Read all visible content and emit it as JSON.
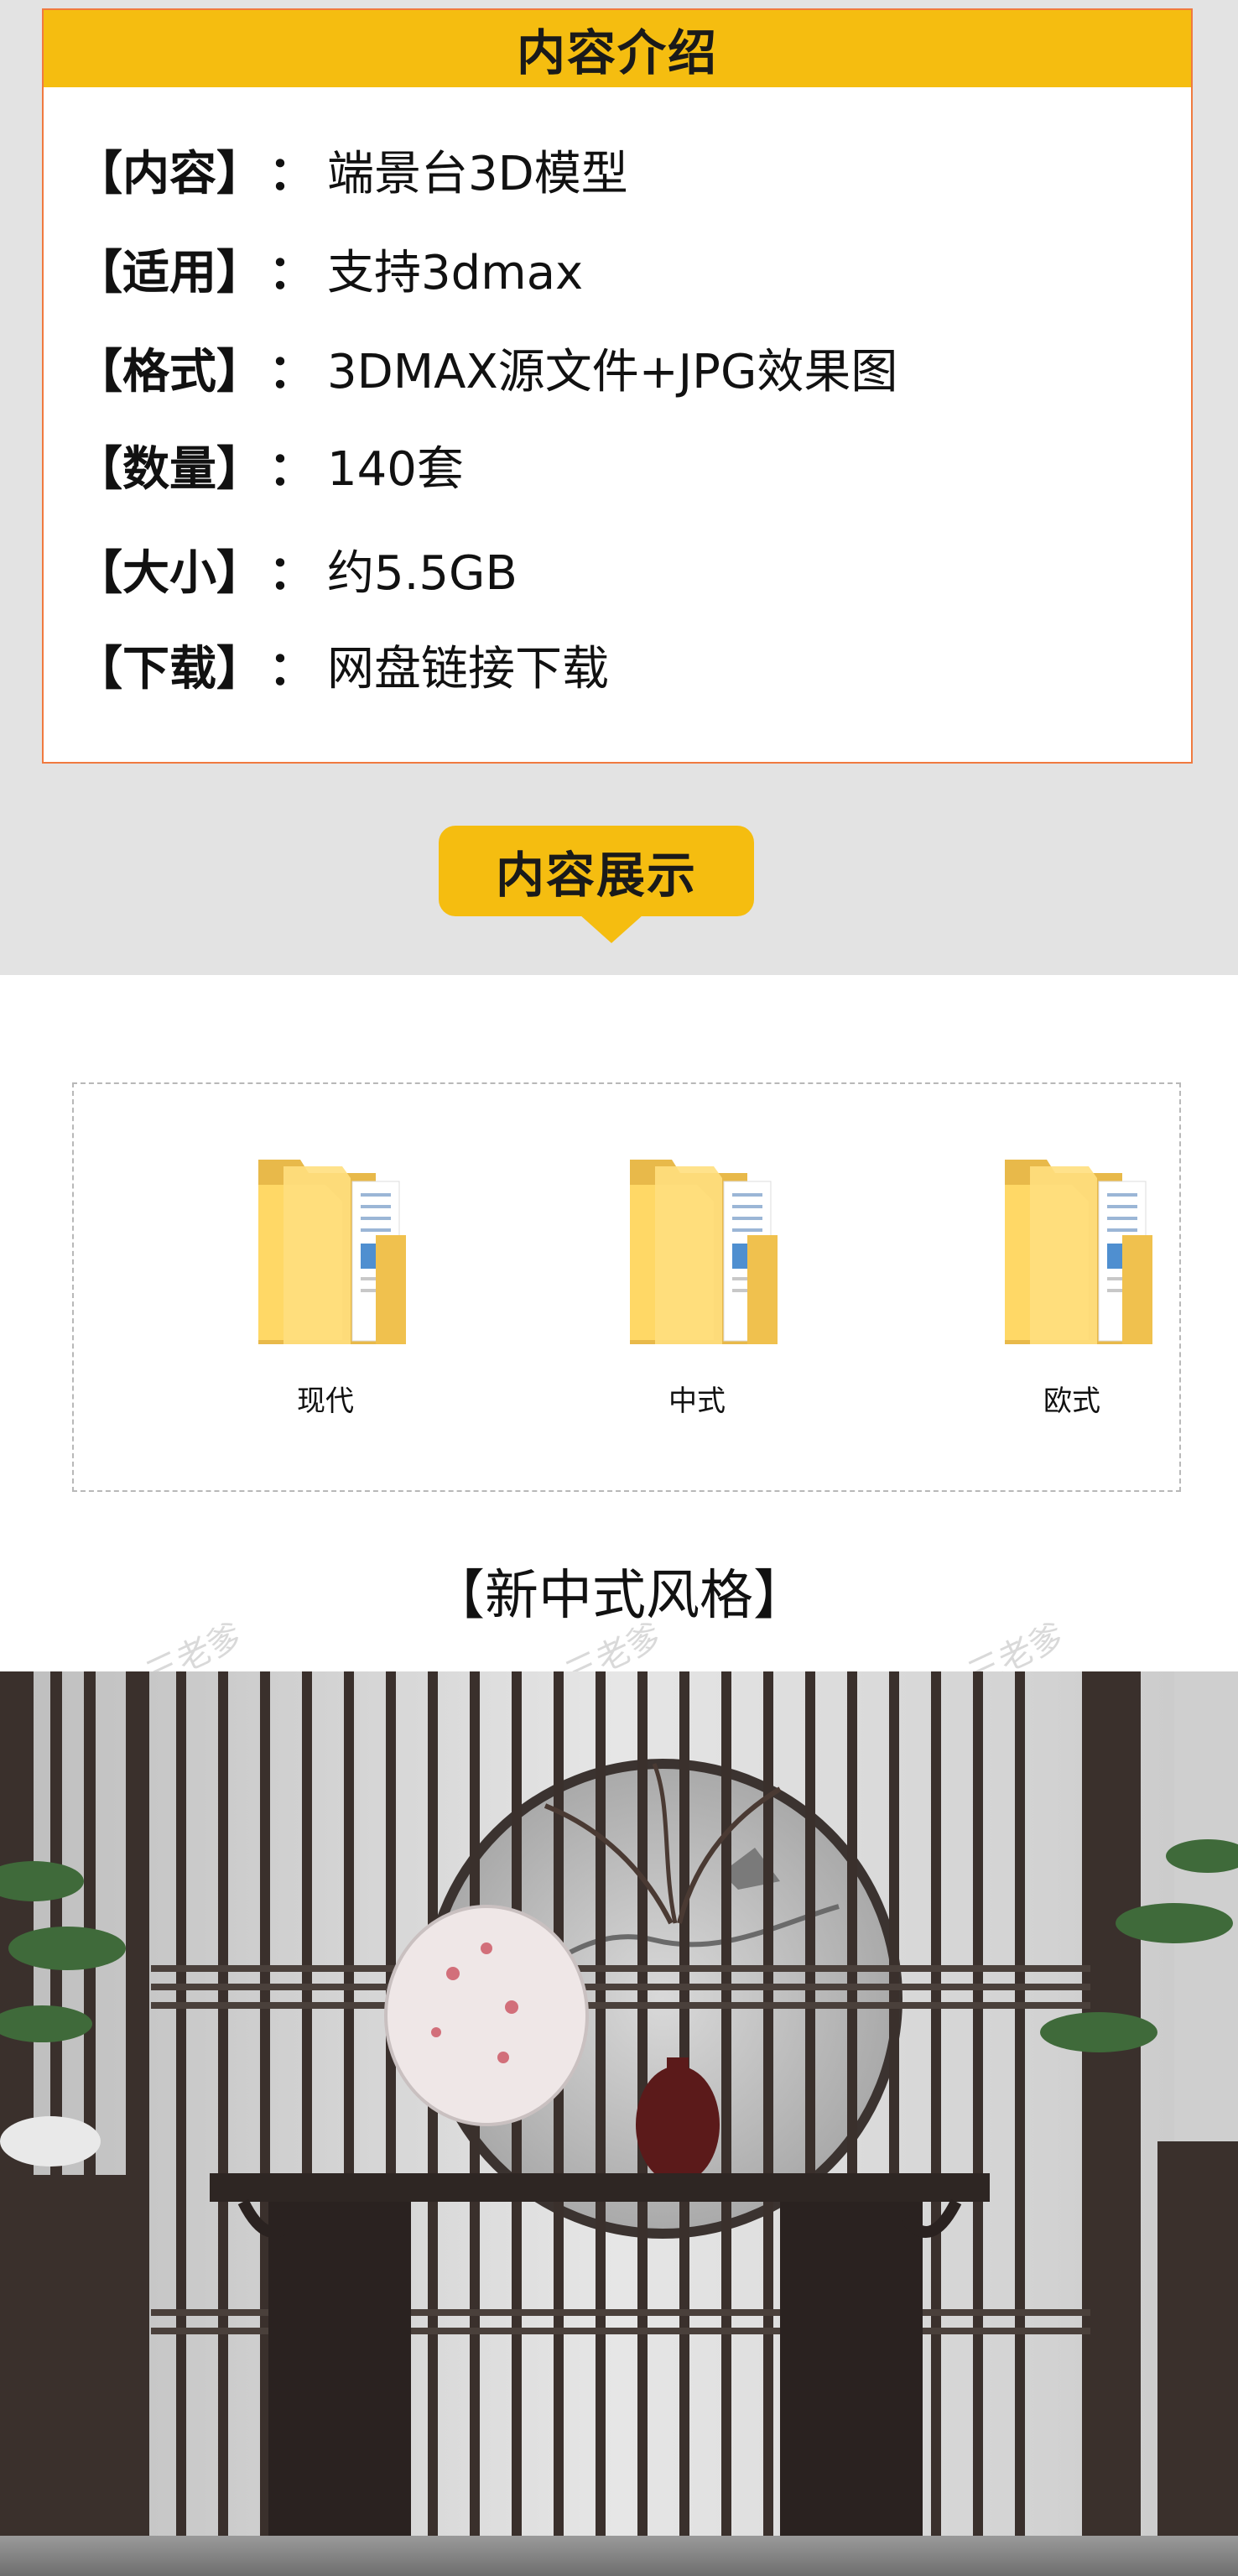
{
  "intro": {
    "title": "内容介绍",
    "rows": [
      {
        "label": "【内容】",
        "sep": "：",
        "value": "端景台3D模型"
      },
      {
        "label": "【适用】",
        "sep": "：",
        "value": "支持3dmax"
      },
      {
        "label": "【格式】",
        "sep": "：",
        "value": "3DMAX源文件+JPG效果图"
      },
      {
        "label": "【数量】",
        "sep": "：",
        "value": "140套"
      },
      {
        "label": "【大小】",
        "sep": "：",
        "value": "约5.5GB"
      },
      {
        "label": "【下载】",
        "sep": "：",
        "value": "网盘链接下载"
      }
    ]
  },
  "display": {
    "badge": "内容展示"
  },
  "folders": [
    {
      "name": "现代",
      "icon": "folder-icon"
    },
    {
      "name": "中式",
      "icon": "folder-icon"
    },
    {
      "name": "欧式",
      "icon": "folder-icon"
    }
  ],
  "style_title": "【新中式风格】",
  "watermark": "三老爹",
  "colors": {
    "accent": "#f5bd10",
    "border": "#f07a40",
    "band": "#e3e3e3"
  }
}
